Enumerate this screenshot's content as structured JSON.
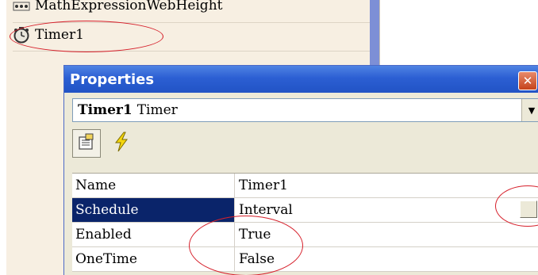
{
  "tree": {
    "items": [
      {
        "label": "MathExpressionWebHeight",
        "icon": "abacus-icon"
      },
      {
        "label": "Timer1",
        "icon": "clock-icon"
      }
    ]
  },
  "properties": {
    "title": "Properties",
    "selector": {
      "object": "Timer1",
      "type": "Timer"
    },
    "toolbar": [
      {
        "name": "properties-view-icon"
      },
      {
        "name": "events-lightning-icon"
      }
    ],
    "rows": [
      {
        "name": "Name",
        "value": "Timer1"
      },
      {
        "name": "Schedule",
        "value": "Interval"
      },
      {
        "name": "Enabled",
        "value": "True"
      },
      {
        "name": "OneTime",
        "value": "False"
      }
    ]
  },
  "colors": {
    "titlebar": "#2c5fd3",
    "selected_row": "#0a246a",
    "annotation": "#d6202b",
    "panel": "#f7efe2"
  }
}
